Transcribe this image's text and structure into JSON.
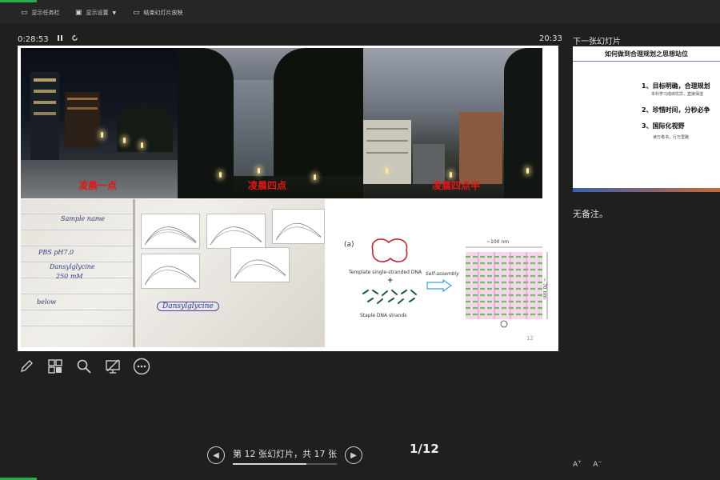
{
  "toolbar": {
    "show_taskbar": "显示任务栏",
    "display_settings": "显示设置",
    "end_slideshow": "结束幻灯片放映"
  },
  "timer": {
    "elapsed": "0:28:53"
  },
  "clock": "20:33",
  "slide": {
    "captions": [
      "凌晨一点",
      "凌晨四点",
      "凌晨四点半"
    ],
    "notebook": {
      "labels": [
        "Dansylglycine",
        "Dansylglycine",
        "Sample name",
        "PBS pH7.0",
        "250 mM",
        "below"
      ]
    },
    "diagram": {
      "panel_label": "(a)",
      "template_label": "Template single-stranded DNA",
      "staple_label": "Staple DNA strands",
      "self_assembly": "Self-assembly",
      "width_label": "~100 nm",
      "height_label": "~ 70 nm",
      "plus": "+"
    },
    "number": "12"
  },
  "tools": [
    "pen-tool",
    "see-all-slides",
    "zoom",
    "black-screen",
    "more-options"
  ],
  "nav": {
    "label": "第 12 张幻灯片，共 17 张",
    "progress": 0.706
  },
  "page_count": "1/12",
  "right_pane": {
    "title": "下一张幻灯片",
    "next_slide": {
      "title": "如何做到合理规划之思想站位",
      "items": [
        {
          "label": "1、目标明确，合理规划",
          "sub": "本科学习成绩优异，直接保送"
        },
        {
          "label": "2、珍惜时间，分秒必争",
          "sub": ""
        },
        {
          "label": "3、国际化视野",
          "sub": "读万卷书，行万里路"
        }
      ]
    },
    "notes": "无备注。"
  },
  "colors": {
    "background": "#1f1f1f",
    "accent_green": "#21b04b",
    "caption_red": "#e01818"
  }
}
